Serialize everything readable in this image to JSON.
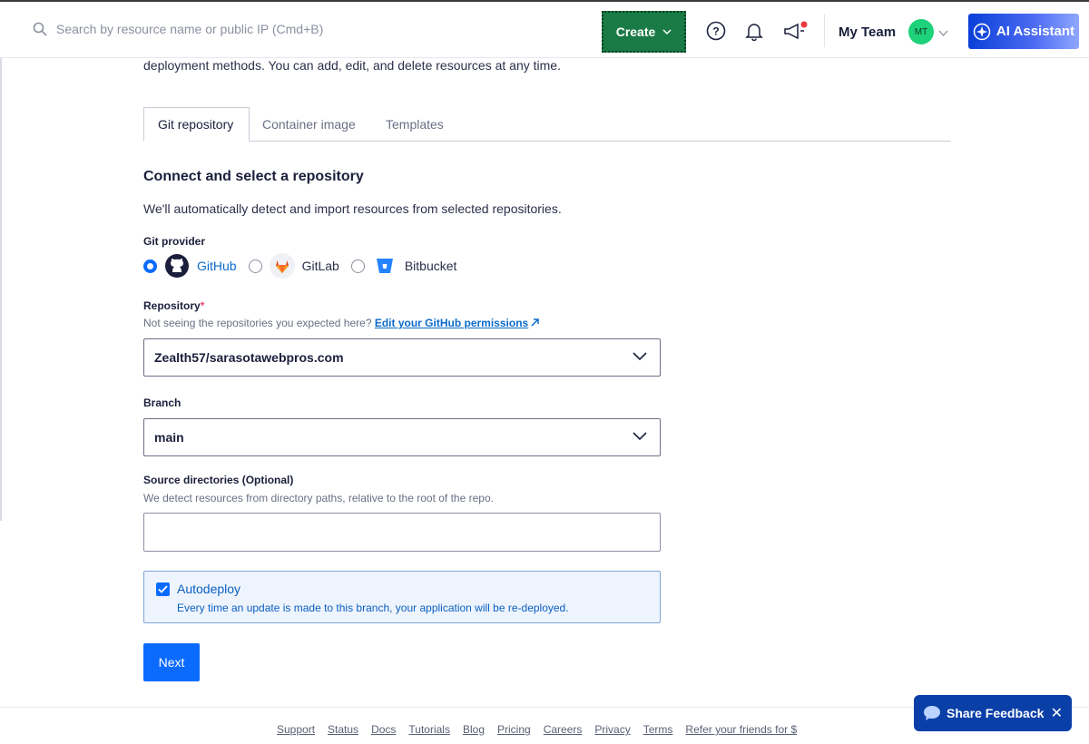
{
  "topbar": {
    "search_placeholder": "Search by resource name or public IP (Cmd+B)",
    "create_label": "Create",
    "team_name": "My Team",
    "avatar_initials": "MT",
    "ai_label": "AI Assistant",
    "colors": {
      "create_bg": "#1a7a45",
      "ai_bg": "#0a3fd8",
      "avatar_bg": "#1dd27a",
      "notification_dot": "#e8383d"
    }
  },
  "intro_text": "deployment methods. You can add, edit, and delete resources at any time.",
  "tabs": [
    {
      "label": "Git repository",
      "active": true
    },
    {
      "label": "Container image",
      "active": false
    },
    {
      "label": "Templates",
      "active": false
    }
  ],
  "section": {
    "title": "Connect and select a repository",
    "description": "We'll automatically detect and import resources from selected repositories."
  },
  "git_provider": {
    "label": "Git provider",
    "options": [
      {
        "label": "GitHub",
        "selected": true,
        "icon": "github-icon"
      },
      {
        "label": "GitLab",
        "selected": false,
        "icon": "gitlab-icon"
      },
      {
        "label": "Bitbucket",
        "selected": false,
        "icon": "bitbucket-icon"
      }
    ]
  },
  "repository": {
    "label": "Repository",
    "required_mark": "*",
    "helper": "Not seeing the repositories you expected here?",
    "helper_link": "Edit your GitHub permissions",
    "value": "Zealth57/sarasotawebpros.com"
  },
  "branch": {
    "label": "Branch",
    "value": "main"
  },
  "source_dirs": {
    "label": "Source directories (Optional)",
    "helper": "We detect resources from directory paths, relative to the root of the repo.",
    "value": ""
  },
  "autodeploy": {
    "checked": true,
    "title": "Autodeploy",
    "description": "Every time an update is made to this branch, your application will be re-deployed."
  },
  "next_label": "Next",
  "footer": {
    "links": [
      "Support",
      "Status",
      "Docs",
      "Tutorials",
      "Blog",
      "Pricing",
      "Careers",
      "Privacy",
      "Terms",
      "Refer your friends for $"
    ]
  },
  "feedback": {
    "label": "Share Feedback",
    "close": "✕"
  }
}
